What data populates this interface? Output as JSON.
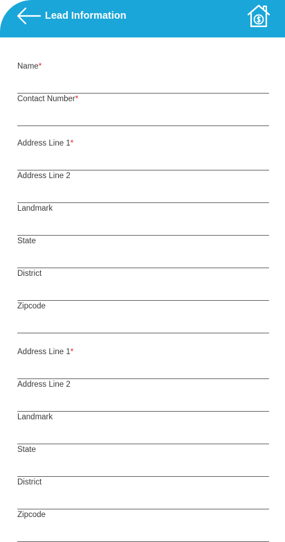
{
  "header": {
    "title": "Lead Information",
    "background": "#1aa6d9",
    "back_icon": "arrow-left-icon",
    "home_icon": "home-dollar-icon"
  },
  "required_marker": "*",
  "required_color": "#e0202c",
  "form": {
    "fields": [
      {
        "label": "Name",
        "required": true
      },
      {
        "label": "Contact Number",
        "required": true
      },
      {
        "label": "Address Line 1",
        "required": true
      },
      {
        "label": "Address Line 2",
        "required": false
      },
      {
        "label": "Landmark",
        "required": false
      },
      {
        "label": "State",
        "required": false
      },
      {
        "label": "District",
        "required": false
      },
      {
        "label": "Zipcode",
        "required": false
      },
      {
        "label": "Address Line 1",
        "required": true
      },
      {
        "label": "Address Line 2",
        "required": false
      },
      {
        "label": "Landmark",
        "required": false
      },
      {
        "label": "State",
        "required": false
      },
      {
        "label": "District",
        "required": false
      },
      {
        "label": "Zipcode",
        "required": false
      }
    ]
  }
}
